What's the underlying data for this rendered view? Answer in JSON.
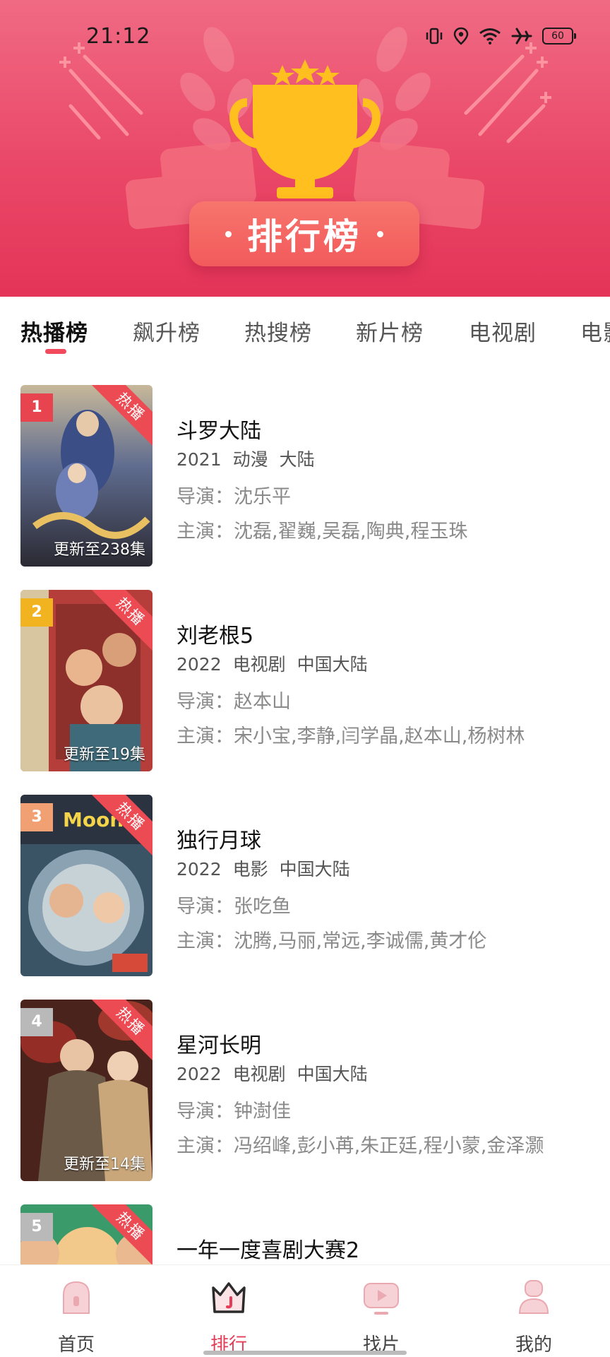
{
  "status_bar": {
    "time": "21:12",
    "battery": "60"
  },
  "header": {
    "title": "排行榜"
  },
  "tabs": [
    {
      "label": "热播榜",
      "active": true
    },
    {
      "label": "飙升榜",
      "active": false
    },
    {
      "label": "热搜榜",
      "active": false
    },
    {
      "label": "新片榜",
      "active": false
    },
    {
      "label": "电视剧",
      "active": false
    },
    {
      "label": "电影",
      "active": false
    }
  ],
  "items": [
    {
      "rank": "1",
      "hot_label": "热播",
      "update": "更新至238集",
      "title": "斗罗大陆",
      "year": "2021",
      "genre": "动漫",
      "region": "大陆",
      "director": "导演：沈乐平",
      "cast": "主演：沈磊,翟巍,吴磊,陶典,程玉珠",
      "rank_color": "#e8444f",
      "poster_colors": [
        "#5f6c8f",
        "#2b3552",
        "#8f6a4a"
      ]
    },
    {
      "rank": "2",
      "hot_label": "热播",
      "update": "更新至19集",
      "title": "刘老根5",
      "year": "2022",
      "genre": "电视剧",
      "region": "中国大陆",
      "director": "导演：赵本山",
      "cast": "主演：宋小宝,李静,闫学晶,赵本山,杨树林",
      "rank_color": "#f1b31f",
      "poster_colors": [
        "#c9483f",
        "#8d2f2a",
        "#d9a07a"
      ]
    },
    {
      "rank": "3",
      "hot_label": "热播",
      "update": "",
      "title": "独行月球",
      "year": "2022",
      "genre": "电影",
      "region": "中国大陆",
      "director": "导演：张吃鱼",
      "cast": "主演：沈腾,马丽,常远,李诚儒,黄才伦",
      "rank_color": "#f0a072",
      "poster_colors": [
        "#6a8397",
        "#35505f",
        "#c8b48f"
      ]
    },
    {
      "rank": "4",
      "hot_label": "热播",
      "update": "更新至14集",
      "title": "星河长明",
      "year": "2022",
      "genre": "电视剧",
      "region": "中国大陆",
      "director": "导演：钟澍佳",
      "cast": "主演：冯绍峰,彭小苒,朱正廷,程小蒙,金泽灏",
      "rank_color": "#b9b9b9",
      "poster_colors": [
        "#6e3325",
        "#2e1a18",
        "#b47a45"
      ]
    },
    {
      "rank": "5",
      "hot_label": "热播",
      "update": "",
      "title": "一年一度喜剧大赛2",
      "year": "",
      "genre": "",
      "region": "",
      "director": "",
      "cast": "",
      "rank_color": "#b9b9b9",
      "poster_colors": [
        "#3a9a6a",
        "#f2c98a",
        "#d46a3a"
      ]
    }
  ],
  "bottom_nav": [
    {
      "label": "首页",
      "icon": "home-icon",
      "active": false
    },
    {
      "label": "排行",
      "icon": "crown-icon",
      "active": true
    },
    {
      "label": "找片",
      "icon": "play-icon",
      "active": false
    },
    {
      "label": "我的",
      "icon": "profile-icon",
      "active": false
    }
  ],
  "colors": {
    "accent": "#e53d57",
    "header_top": "#f06a84",
    "header_bottom": "#e43458",
    "trophy": "#ffbf1f"
  }
}
